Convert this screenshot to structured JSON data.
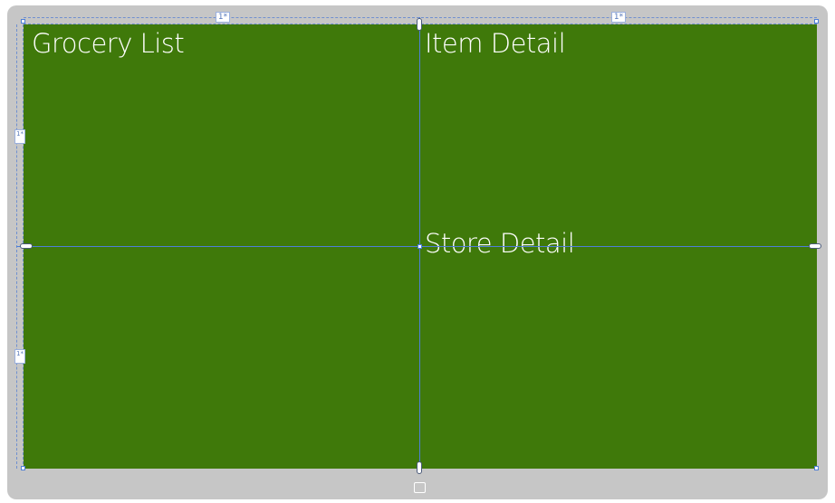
{
  "grid": {
    "column_size_1": "1*",
    "column_size_2": "1*",
    "row_size_1": "1*",
    "row_size_2": "1*"
  },
  "cells": {
    "grocery_list": "Grocery List",
    "item_detail": "Item Detail",
    "store_detail": "Store Detail"
  },
  "colors": {
    "canvas_bg": "#3f790a",
    "frame_bg": "#c6c6c6",
    "gridline": "#4d7fd8",
    "text": "#ffffff"
  },
  "icons": [
    "device-frame-icon",
    "splitter-handle-icon",
    "row-size-icon",
    "column-size-icon"
  ]
}
